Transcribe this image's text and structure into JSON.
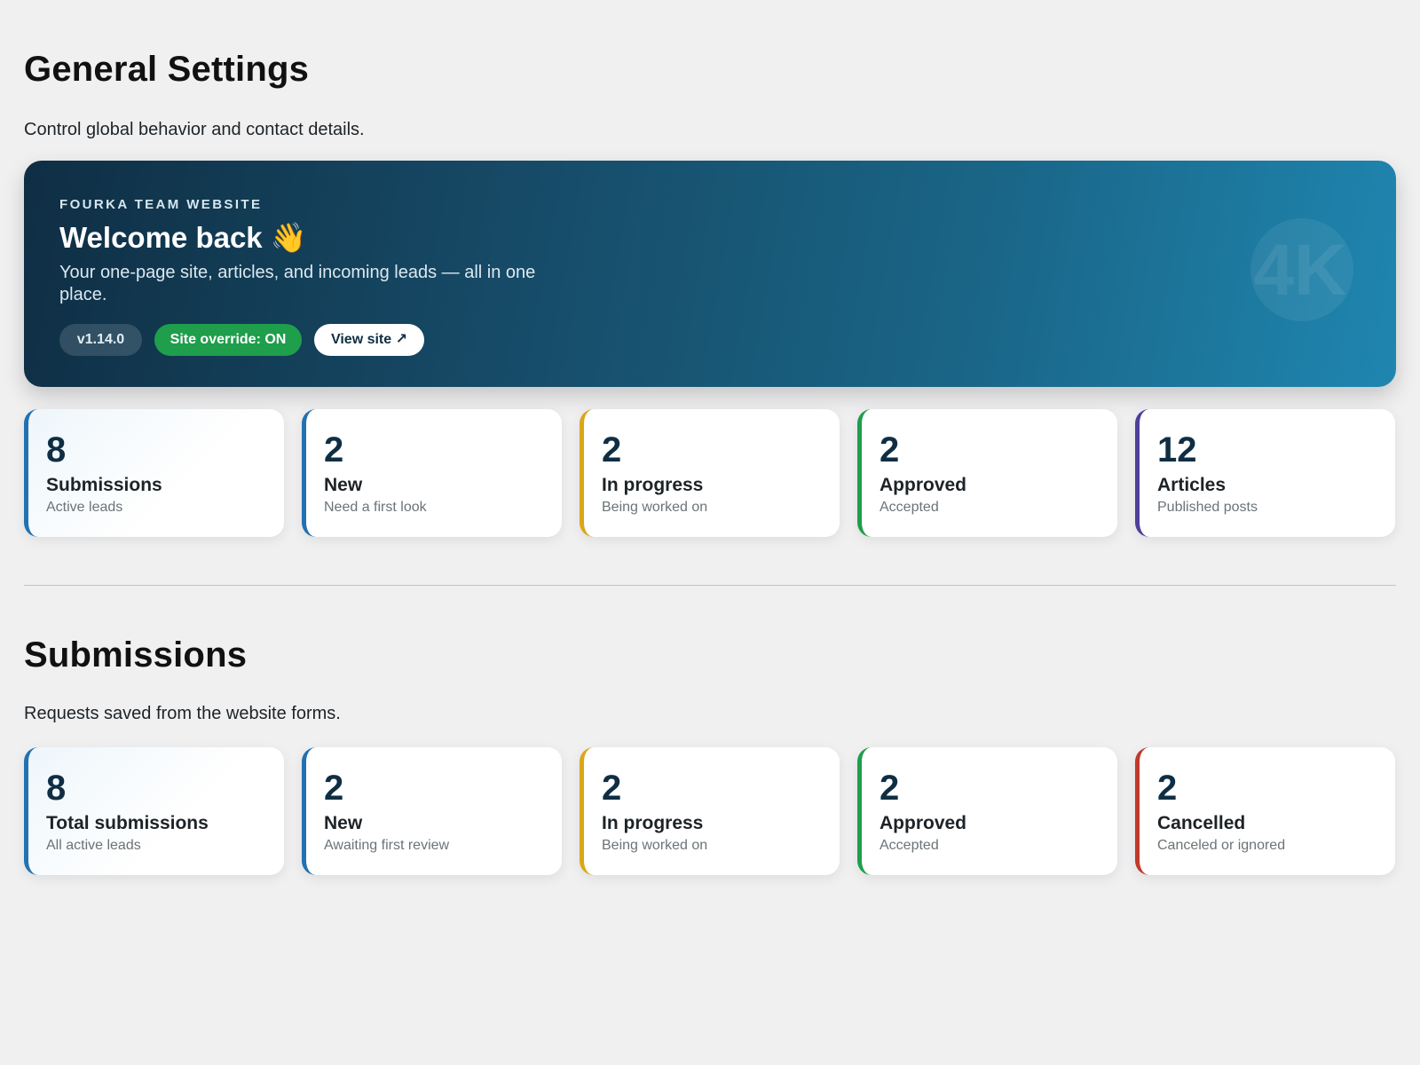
{
  "general": {
    "title": "General Settings",
    "description": "Control global behavior and contact details."
  },
  "hero": {
    "eyebrow": "FOURKA TEAM WEBSITE",
    "title": "Welcome back 👋",
    "subtitle": "Your one-page site, articles, and incoming leads — all in one place.",
    "version": "v1.14.0",
    "override": "Site override: ON",
    "view_site": "View site ↗",
    "logo_text": "4K"
  },
  "overview_stats": [
    {
      "value": "8",
      "label": "Submissions",
      "hint": "Active leads",
      "color": "#2271b1"
    },
    {
      "value": "2",
      "label": "New",
      "hint": "Need a first look",
      "color": "#2271b1"
    },
    {
      "value": "2",
      "label": "In progress",
      "hint": "Being worked on",
      "color": "#dba617"
    },
    {
      "value": "2",
      "label": "Approved",
      "hint": "Accepted",
      "color": "#1f9e4c"
    },
    {
      "value": "12",
      "label": "Articles",
      "hint": "Published posts",
      "color": "#4f3f9a"
    }
  ],
  "submissions": {
    "title": "Submissions",
    "description": "Requests saved from the website forms.",
    "stats": [
      {
        "value": "8",
        "label": "Total submissions",
        "hint": "All active leads",
        "color": "#2271b1"
      },
      {
        "value": "2",
        "label": "New",
        "hint": "Awaiting first review",
        "color": "#2271b1"
      },
      {
        "value": "2",
        "label": "In progress",
        "hint": "Being worked on",
        "color": "#dba617"
      },
      {
        "value": "2",
        "label": "Approved",
        "hint": "Accepted",
        "color": "#1f9e4c"
      },
      {
        "value": "2",
        "label": "Cancelled",
        "hint": "Canceled or ignored",
        "color": "#c0392b"
      }
    ]
  }
}
